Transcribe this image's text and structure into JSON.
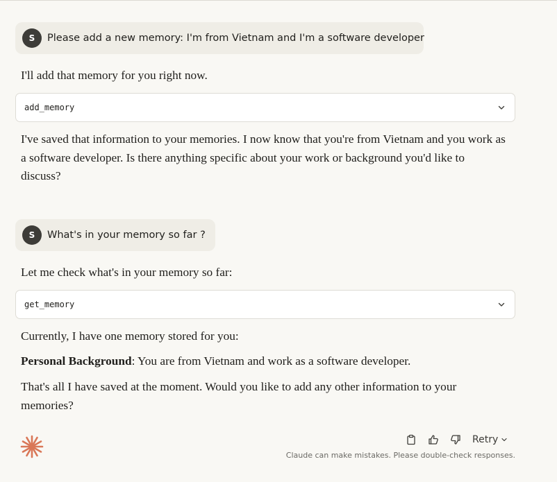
{
  "conversation": {
    "turn1": {
      "user": {
        "avatar_initial": "S",
        "text": "Please add a new memory: I'm from Vietnam and I'm a software developer"
      },
      "assistant_intro": "I'll add that memory for you right now.",
      "tool": {
        "name": "add_memory",
        "icon": "chevron-down-icon"
      },
      "assistant_reply": "I've saved that information to your memories. I now know that you're from Vietnam and you work as a software developer. Is there anything specific about your work or background you'd like to discuss?"
    },
    "turn2": {
      "user": {
        "avatar_initial": "S",
        "text": "What's in your memory so far ?"
      },
      "assistant_intro": "Let me check what's in your memory so far:",
      "tool": {
        "name": "get_memory",
        "icon": "chevron-down-icon"
      },
      "reply_line1": "Currently, I have one memory stored for you:",
      "memory_item": {
        "title": "Personal Background",
        "text": ": You are from Vietnam and work as a software developer."
      },
      "reply_line3": "That's all I have saved at the moment. Would you like to add any other information to your memories?"
    }
  },
  "footer": {
    "actions": [
      {
        "icon": "copy-icon"
      },
      {
        "icon": "thumbs-up-icon"
      },
      {
        "icon": "thumbs-down-icon"
      }
    ],
    "retry_label": "Retry",
    "disclaimer": "Claude can make mistakes. Please double-check responses."
  },
  "colors": {
    "background": "#f9f8f4",
    "user_bubble": "#efede6",
    "avatar": "#3d3c38",
    "brand_accent": "#d97757"
  },
  "icons": {
    "logo": "claude-asterisk-logo"
  }
}
